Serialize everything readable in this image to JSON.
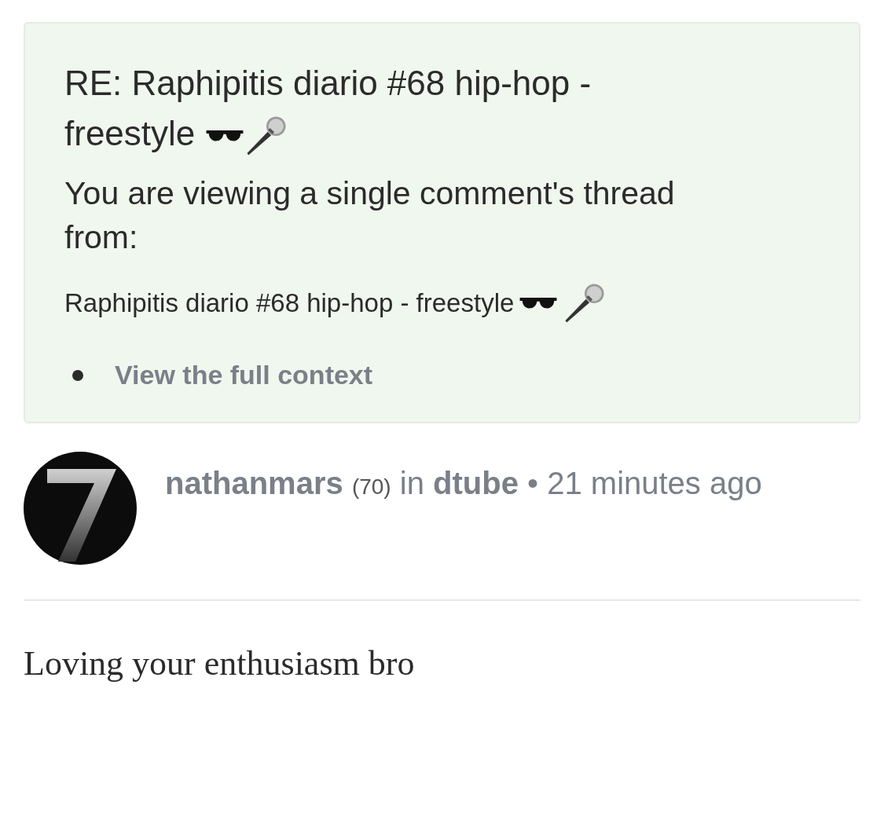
{
  "thread_notice": {
    "title": "RE: Raphipitis diario #68 hip-hop - freestyle",
    "message": "You are viewing a single comment's thread from:",
    "post_title": "Raphipitis diario #68 hip-hop - freestyle",
    "links": [
      "View the full context"
    ]
  },
  "comment": {
    "author": "nathanmars",
    "reputation": "(70)",
    "preposition": "in",
    "community": "dtube",
    "separator": "•",
    "time": "21 minutes ago",
    "body": "Loving your enthusiasm bro"
  }
}
